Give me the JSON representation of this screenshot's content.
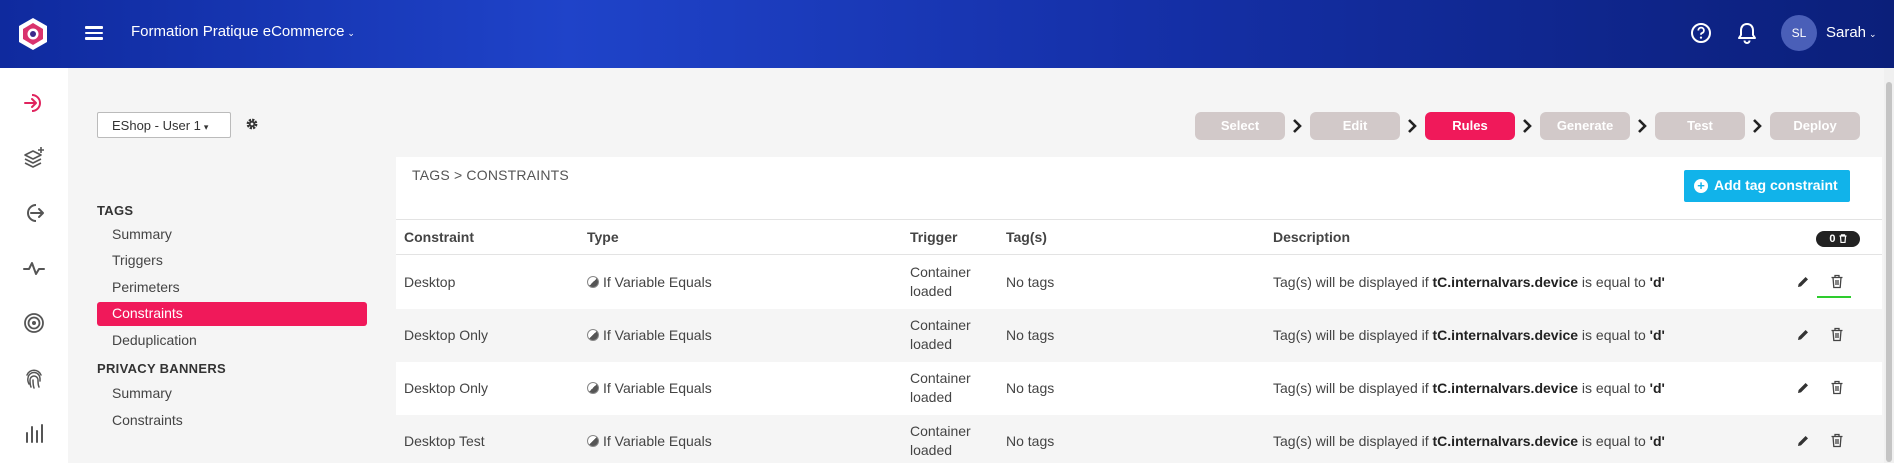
{
  "header": {
    "site_name": "Formation Pratique eCommerce",
    "user_initials": "SL",
    "user_name": "Sarah"
  },
  "rail": {
    "icons": [
      "login-icon",
      "layers-plus-icon",
      "logout-icon",
      "pulse-icon",
      "target-icon",
      "fingerprint-icon",
      "bar-chart-icon"
    ]
  },
  "container_select": {
    "value": "EShop - User 1"
  },
  "nav": {
    "tags_title": "TAGS",
    "tags_items": [
      {
        "label": "Summary"
      },
      {
        "label": "Triggers"
      },
      {
        "label": "Perimeters"
      },
      {
        "label": "Constraints",
        "active": true
      },
      {
        "label": "Deduplication"
      }
    ],
    "privacy_title": "PRIVACY BANNERS",
    "privacy_items": [
      {
        "label": "Summary"
      },
      {
        "label": "Constraints"
      }
    ]
  },
  "steps": [
    {
      "label": "Select"
    },
    {
      "label": "Edit"
    },
    {
      "label": "Rules",
      "active": true
    },
    {
      "label": "Generate"
    },
    {
      "label": "Test"
    },
    {
      "label": "Deploy"
    }
  ],
  "card": {
    "breadcrumb": "TAGS > CONSTRAINTS",
    "add_button": "Add tag constraint",
    "count_badge": "0",
    "columns": {
      "constraint": "Constraint",
      "type": "Type",
      "trigger": "Trigger",
      "tags": "Tag(s)",
      "description": "Description"
    },
    "rows": [
      {
        "constraint": "Desktop",
        "type": "If Variable Equals",
        "trigger_l1": "Container",
        "trigger_l2": "loaded",
        "tags": "No tags",
        "desc_prefix": "Tag(s) will be displayed if ",
        "desc_var": "tC.internalvars.device",
        "desc_mid": " is equal to ",
        "desc_val": "'d'"
      },
      {
        "constraint": "Desktop Only",
        "type": "If Variable Equals",
        "trigger_l1": "Container",
        "trigger_l2": "loaded",
        "tags": "No tags",
        "desc_prefix": "Tag(s) will be displayed if ",
        "desc_var": "tC.internalvars.device",
        "desc_mid": " is equal to ",
        "desc_val": "'d'"
      },
      {
        "constraint": "Desktop Only",
        "type": "If Variable Equals",
        "trigger_l1": "Container",
        "trigger_l2": "loaded",
        "tags": "No tags",
        "desc_prefix": "Tag(s) will be displayed if ",
        "desc_var": "tC.internalvars.device",
        "desc_mid": " is equal to ",
        "desc_val": "'d'"
      },
      {
        "constraint": "Desktop Test",
        "type": "If Variable Equals",
        "trigger_l1": "Container",
        "trigger_l2": "loaded",
        "tags": "No tags",
        "desc_prefix": "Tag(s) will be displayed if ",
        "desc_var": "tC.internalvars.device",
        "desc_mid": " is equal to ",
        "desc_val": "'d'"
      }
    ]
  },
  "colors": {
    "accent": "#f0195a",
    "primary_button": "#11b3ea",
    "step_inactive": "#d2c9c9"
  }
}
